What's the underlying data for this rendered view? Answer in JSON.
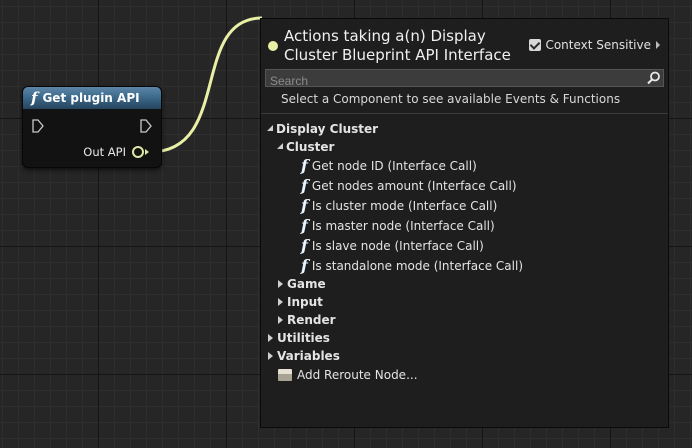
{
  "node": {
    "title": "Get plugin API",
    "output_pin_label": "Out API"
  },
  "menu": {
    "title": "Actions taking a(n) Display Cluster Blueprint API Interface",
    "context_sensitive_label": "Context Sensitive",
    "context_sensitive_checked": true,
    "search_placeholder": "Search",
    "hint": "Select a Component to see available Events & Functions",
    "categories": {
      "display_cluster": "Display Cluster",
      "cluster": "Cluster",
      "game": "Game",
      "input": "Input",
      "render": "Render",
      "utilities": "Utilities",
      "variables": "Variables"
    },
    "functions": [
      "Get node ID (Interface Call)",
      "Get nodes amount (Interface Call)",
      "Is cluster mode (Interface Call)",
      "Is master node (Interface Call)",
      "Is slave node (Interface Call)",
      "Is standalone mode (Interface Call)"
    ],
    "reroute_label": "Add Reroute Node..."
  },
  "icons": {
    "function": "function-icon",
    "search": "search-icon",
    "reroute": "reroute-node-icon"
  },
  "colors": {
    "wire": "#e9f0a6",
    "node_header": "#3d6a8c",
    "panel_bg": "#1e1e1e"
  }
}
